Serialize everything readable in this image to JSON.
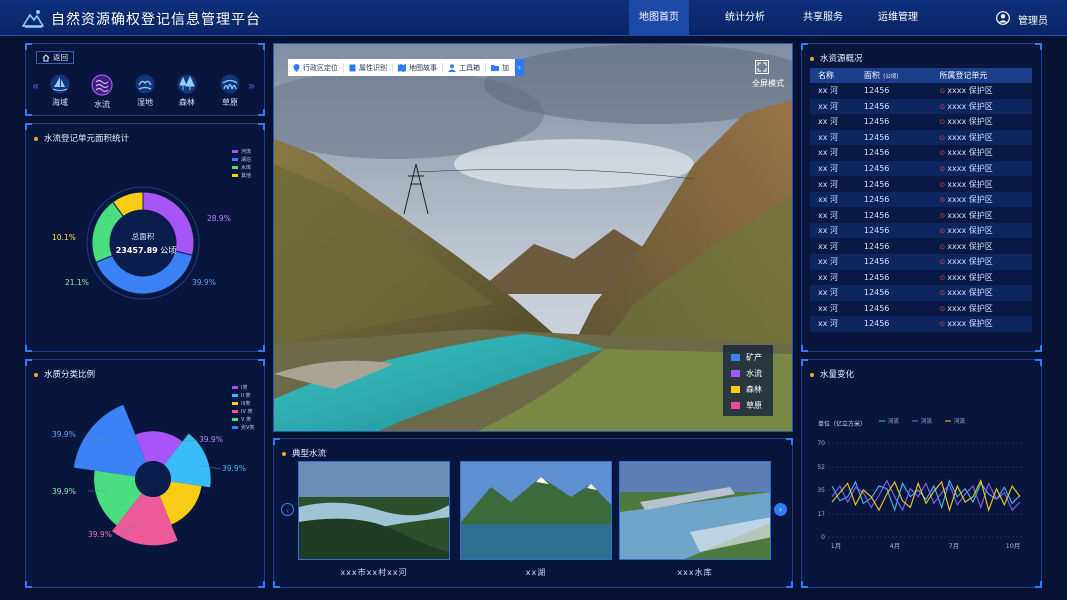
{
  "header": {
    "title": "自然资源确权登记信息管理平台",
    "nav": [
      "地图首页",
      "统计分析",
      "共享服务",
      "运维管理"
    ],
    "active_nav": "地图首页",
    "user": "管理员",
    "accent": "#2f7bff"
  },
  "tabs": {
    "back": "返回",
    "items": [
      {
        "label": "海域",
        "icon": "sailboat-icon"
      },
      {
        "label": "水流",
        "icon": "water-flow-icon"
      },
      {
        "label": "湿地",
        "icon": "wetland-icon"
      },
      {
        "label": "森林",
        "icon": "forest-icon"
      },
      {
        "label": "草原",
        "icon": "grassland-icon"
      }
    ],
    "active": "水流"
  },
  "donut": {
    "title": "水流登记单元面积统计",
    "center_label": "总面积",
    "center_value": "23457.89",
    "center_unit": "公顷",
    "labels": [
      "28.9%",
      "39.9%",
      "21.1%",
      "10.1%"
    ]
  },
  "rose": {
    "title": "水质分类比例",
    "labels": [
      "39.9%",
      "39.9%",
      "39.9%",
      "39.9%",
      "39.9%"
    ]
  },
  "map": {
    "tools": [
      "行政区定位",
      "属性识别",
      "地图故事",
      "工具箱",
      "加"
    ],
    "fullscreen": "全屏模式",
    "legend": [
      {
        "label": "矿产",
        "color": "#3b82f6"
      },
      {
        "label": "水流",
        "color": "#a855f7"
      },
      {
        "label": "森林",
        "color": "#facc15"
      },
      {
        "label": "草原",
        "color": "#ec4899"
      }
    ]
  },
  "gallery": {
    "title": "典型水流",
    "items": [
      "xxx市xx村xx河",
      "xx湖",
      "xxx水库"
    ]
  },
  "resources": {
    "title": "水资源概况",
    "headers": [
      "名称",
      "面积",
      "（公顷）",
      "所属登记单元"
    ],
    "rows": [
      [
        "xx 河",
        "12456",
        "xxxx 保护区"
      ],
      [
        "xx 河",
        "12456",
        "xxxx 保护区"
      ],
      [
        "xx 河",
        "12456",
        "xxxx 保护区"
      ],
      [
        "xx 河",
        "12456",
        "xxxx 保护区"
      ],
      [
        "xx 河",
        "12456",
        "xxxx 保护区"
      ],
      [
        "xx 河",
        "12456",
        "xxxx 保护区"
      ],
      [
        "xx 河",
        "12456",
        "xxxx 保护区"
      ],
      [
        "xx 河",
        "12456",
        "xxxx 保护区"
      ],
      [
        "xx 河",
        "12456",
        "xxxx 保护区"
      ],
      [
        "xx 河",
        "12456",
        "xxxx 保护区"
      ],
      [
        "xx 河",
        "12456",
        "xxxx 保护区"
      ],
      [
        "xx 河",
        "12456",
        "xxxx 保护区"
      ],
      [
        "xx 河",
        "12456",
        "xxxx 保护区"
      ],
      [
        "xx 河",
        "12456",
        "xxxx 保护区"
      ],
      [
        "xx 河",
        "12456",
        "xxxx 保护区"
      ],
      [
        "xx 河",
        "12456",
        "xxxx 保护区"
      ]
    ]
  },
  "chart_data": [
    {
      "type": "pie",
      "variant": "donut",
      "title": "水流登记单元面积统计",
      "legend": [
        "河流",
        "湖泊",
        "水库",
        "其他"
      ],
      "legend_position": "top-right",
      "slices": [
        {
          "name": "河流",
          "value": 28.9,
          "color": "#a855f7"
        },
        {
          "name": "湖泊",
          "value": 39.9,
          "color": "#3b82f6"
        },
        {
          "name": "水库",
          "value": 21.1,
          "color": "#4ade80"
        },
        {
          "name": "其他",
          "value": 10.1,
          "color": "#facc15"
        }
      ]
    },
    {
      "type": "pie",
      "variant": "rose",
      "title": "水质分类比例",
      "legend": [
        "I类",
        "II 类",
        "III类",
        "IV 类",
        "V 类",
        "劣V类"
      ],
      "legend_position": "top-right",
      "slices": [
        {
          "name": "劣V类",
          "value": 100,
          "color": "#3b82f6"
        },
        {
          "name": "I类",
          "value": 48,
          "color": "#a855f7"
        },
        {
          "name": "II 类",
          "value": 64,
          "color": "#38bdf8"
        },
        {
          "name": "III类",
          "value": 50,
          "color": "#facc15"
        },
        {
          "name": "IV 类",
          "value": 78,
          "color": "#ec5a9a"
        },
        {
          "name": "V 类",
          "value": 66,
          "color": "#4ade80"
        }
      ]
    },
    {
      "type": "line",
      "title": "水量变化",
      "ylabel": "单位（亿立方米）",
      "ylim": [
        0,
        70
      ],
      "yticks": [
        0,
        17,
        35,
        52,
        70
      ],
      "grid": true,
      "legend_position": "top",
      "xticks": [
        "1月",
        "4月",
        "7月",
        "10月"
      ],
      "series": [
        {
          "name": "河流",
          "color": "#38bdf8",
          "values": [
            38,
            27,
            30,
            41,
            25,
            29,
            38,
            36,
            20,
            40,
            30,
            35,
            28,
            38,
            22,
            42,
            30,
            36,
            26,
            40,
            32,
            28,
            37,
            25,
            31
          ]
        },
        {
          "name": "河流",
          "color": "#8b5cf6",
          "values": [
            30,
            38,
            26,
            37,
            33,
            22,
            31,
            42,
            30,
            20,
            36,
            30,
            40,
            25,
            33,
            39,
            24,
            32,
            38,
            22,
            40,
            28,
            33,
            20,
            26
          ]
        },
        {
          "name": "河流",
          "color": "#facc15",
          "values": [
            26,
            33,
            40,
            24,
            35,
            30,
            20,
            32,
            41,
            27,
            22,
            40,
            25,
            34,
            41,
            20,
            38,
            26,
            30,
            42,
            20,
            36,
            24,
            38,
            30
          ]
        }
      ]
    }
  ]
}
